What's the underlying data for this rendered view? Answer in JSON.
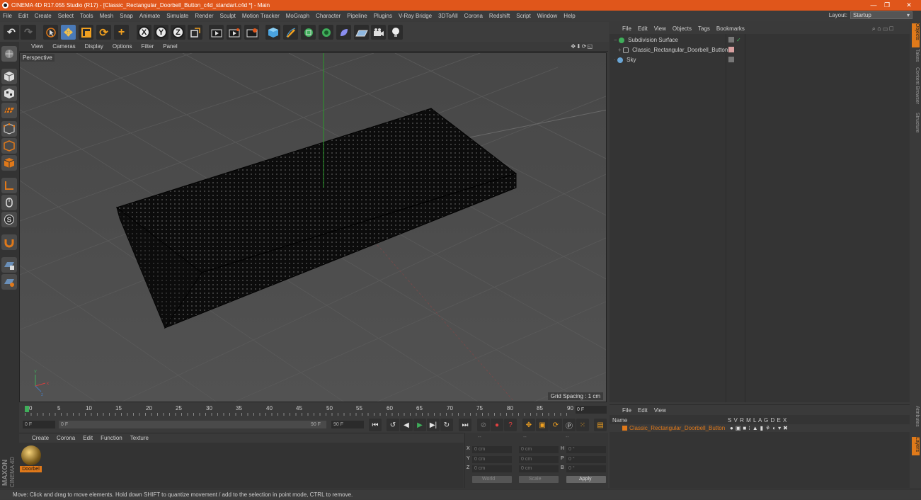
{
  "window": {
    "title": "CINEMA 4D R17.055 Studio (R17) - [Classic_Rectangular_Doorbell_Button_c4d_standart.c4d *] - Main",
    "minimize": "—",
    "restore": "❐",
    "close": "✕"
  },
  "menubar": [
    "File",
    "Edit",
    "Create",
    "Select",
    "Tools",
    "Mesh",
    "Snap",
    "Animate",
    "Simulate",
    "Render",
    "Sculpt",
    "Motion Tracker",
    "MoGraph",
    "Character",
    "Pipeline",
    "Plugins",
    "V-Ray Bridge",
    "3DToAll",
    "Corona",
    "Redshift",
    "Script",
    "Window",
    "Help"
  ],
  "layout": {
    "label": "Layout:",
    "value": "Startup"
  },
  "toolbar": {
    "x_label": "X",
    "y_label": "Y",
    "z_label": "Z"
  },
  "viewport": {
    "menu": [
      "View",
      "Cameras",
      "Display",
      "Options",
      "Filter",
      "Panel"
    ],
    "icons": "✥⬇⟳◱",
    "label": "Perspective",
    "grid_spacing": "Grid Spacing : 1 cm",
    "axis_y": "Y",
    "axis_x": "x",
    "axis_z": "z"
  },
  "timeline": {
    "ticks": [
      "0",
      "5",
      "10",
      "15",
      "20",
      "25",
      "30",
      "35",
      "40",
      "45",
      "50",
      "55",
      "60",
      "65",
      "70",
      "75",
      "80",
      "85",
      "90"
    ],
    "current": "0 F"
  },
  "transport": {
    "start": "0 F",
    "range_start": "0 F",
    "range_end": "90 F",
    "end": "90 F"
  },
  "material_menu": [
    "Create",
    "Corona",
    "Edit",
    "Function",
    "Texture"
  ],
  "material": {
    "name": "Doorbel"
  },
  "brand": {
    "maxon": "MAXON",
    "product": "CINEMA 4D"
  },
  "coords": {
    "header": [
      "--",
      "--",
      "--"
    ],
    "rows": [
      {
        "a": "X",
        "av": "0 cm",
        "b": "X",
        "bv": "0 cm",
        "c": "H",
        "cv": "0 °"
      },
      {
        "a": "Y",
        "av": "0 cm",
        "b": "Y",
        "bv": "0 cm",
        "c": "P",
        "cv": "0 °"
      },
      {
        "a": "Z",
        "av": "0 cm",
        "b": "Z",
        "bv": "0 cm",
        "c": "B",
        "cv": "0 °"
      }
    ],
    "world": "World",
    "scale": "Scale",
    "apply": "Apply"
  },
  "status": "Move: Click and drag to move elements. Hold down SHIFT to quantize movement / add to the selection in point mode, CTRL to remove.",
  "objects": {
    "menu": [
      "File",
      "Edit",
      "View",
      "Objects",
      "Tags",
      "Bookmarks"
    ],
    "items": [
      {
        "name": "Subdivision Surface",
        "icon_color": "#3fae5a"
      },
      {
        "name": "Classic_Rectangular_Doorbell_Button",
        "icon_color": "#9a9a9a"
      },
      {
        "name": "Sky",
        "icon_color": "#6aa6d6"
      }
    ]
  },
  "layers": {
    "menu": [
      "File",
      "Edit",
      "View"
    ],
    "header_name": "Name",
    "header_flags": "S V R M L A G D E X",
    "row_name": "Classic_Rectangular_Doorbell_Button",
    "row_color": "#e0791a"
  },
  "side_tabs": [
    "Objects",
    "Takes",
    "Content Browser",
    "Structure"
  ],
  "side_tabs_lower": [
    "Attributes",
    "Layers"
  ]
}
